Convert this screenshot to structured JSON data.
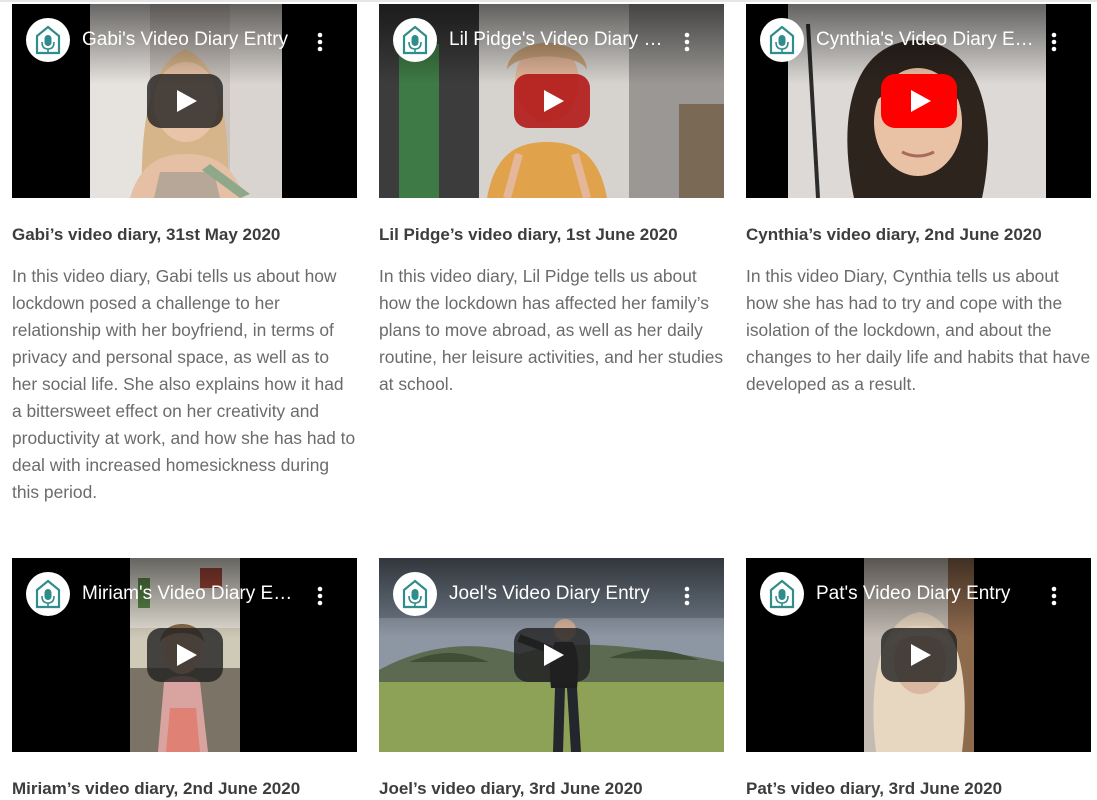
{
  "icons": {
    "channel": "birdhouse-microphone-logo-icon",
    "more": "more-vert-icon",
    "play": "play-button-icon"
  },
  "colors": {
    "play_red": "#ff0000",
    "play_dark": "#212121",
    "logo_teal": "#2f8d8b",
    "title_text": "#3d3d3d",
    "body_text": "#6b6b6b"
  },
  "videos": [
    {
      "video_title": "Gabi's Video Diary Entry",
      "card_title": "Gabi’s video diary, 31st May 2020",
      "description": "In this video diary, Gabi tells us about how lockdown posed a challenge to her relationship with her boyfriend, in terms of privacy and personal space, as well as to her social life. She also explains how it had a bittersweet effect on her creativity and productivity at work, and how she has had to deal with increased homesickness during this period."
    },
    {
      "video_title": "Lil Pidge's Video Diary Entry",
      "card_title": "Lil Pidge’s video diary, 1st June 2020",
      "description": "In this video diary, Lil Pidge tells us about how the lockdown has affected her family’s plans to move abroad, as well as her daily routine, her leisure activities, and her studies at school."
    },
    {
      "video_title": "Cynthia's Video Diary Entry",
      "card_title": "Cynthia’s video diary, 2nd June 2020",
      "description": "In this video Diary, Cynthia tells us about how she has had to try and cope with the isolation of the lockdown, and about the changes to her daily life and habits that have developed as a result."
    },
    {
      "video_title": "Miriam's Video Diary Entry",
      "card_title": "Miriam’s video diary, 2nd June 2020",
      "description": ""
    },
    {
      "video_title": "Joel's Video Diary Entry",
      "card_title": "Joel’s video diary, 3rd June 2020",
      "description": ""
    },
    {
      "video_title": "Pat's Video Diary Entry",
      "card_title": "Pat’s video diary, 3rd June 2020",
      "description": ""
    }
  ]
}
